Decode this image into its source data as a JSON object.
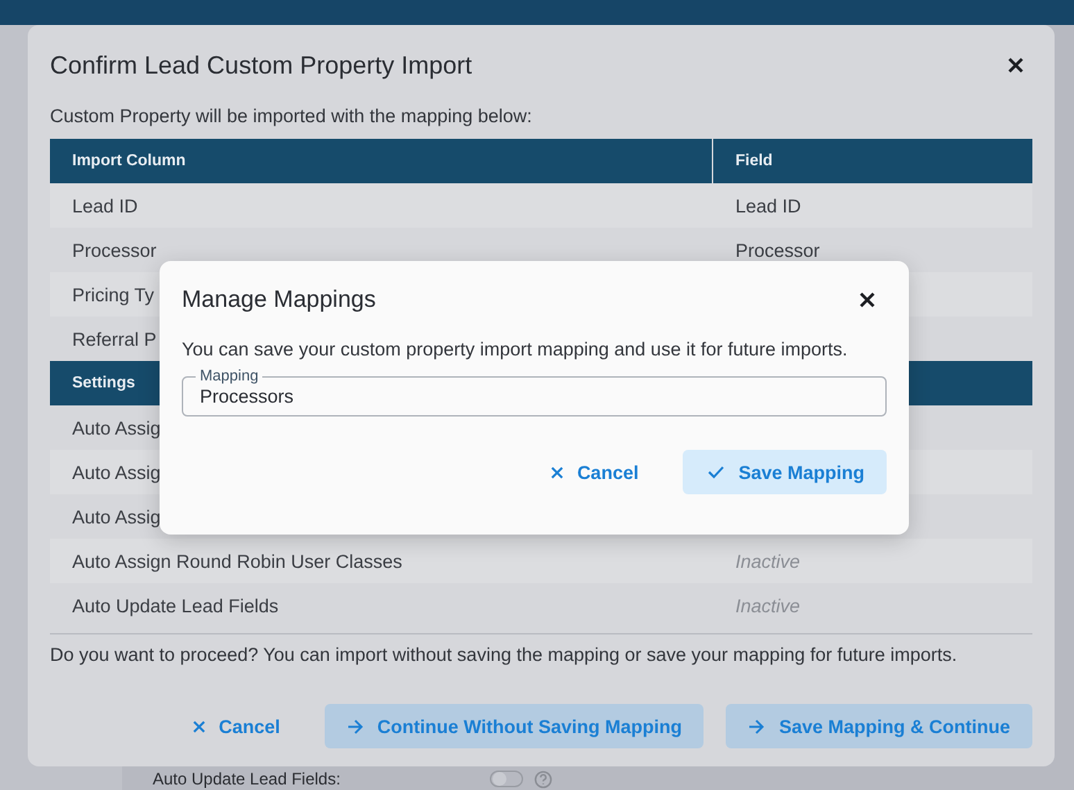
{
  "background": {
    "field_label": "Auto Update Lead Fields:",
    "toggle": {
      "on": false
    }
  },
  "dialog": {
    "title": "Confirm Lead Custom Property Import",
    "intro": "Custom Property will be imported with the mapping below:",
    "columns": [
      "Import Column",
      "Field"
    ],
    "rows": [
      {
        "kind": "row",
        "column": "Lead ID",
        "field": "Lead ID"
      },
      {
        "kind": "row",
        "column": "Processor",
        "field": "Processor"
      },
      {
        "kind": "row",
        "column": "Pricing Ty"
      },
      {
        "kind": "row",
        "column": "Referral P"
      },
      {
        "kind": "section",
        "column": "Settings"
      },
      {
        "kind": "setting",
        "column": "Auto Assig"
      },
      {
        "kind": "setting",
        "column": "Auto Assig"
      },
      {
        "kind": "setting",
        "column": "Auto Assig"
      },
      {
        "kind": "setting",
        "column": "Auto Assign Round Robin User Classes",
        "status": "Inactive"
      },
      {
        "kind": "setting",
        "column": "Auto Update Lead Fields",
        "status": "Inactive"
      }
    ],
    "question": "Do you want to proceed? You can import without saving the mapping or save your mapping for future imports.",
    "buttons": [
      {
        "label": "Cancel",
        "kind": "text"
      },
      {
        "label": "Continue Without Saving Mapping",
        "kind": "filled"
      },
      {
        "label": "Save Mapping & Continue",
        "kind": "filled"
      }
    ]
  },
  "manage_dialog": {
    "title": "Manage Mappings",
    "text": "You can save your custom property import mapping and use it for future imports.",
    "field": {
      "label": "Mapping",
      "value": "Processors"
    },
    "buttons": [
      {
        "label": "Cancel",
        "kind": "text"
      },
      {
        "label": "Save Mapping",
        "kind": "filled"
      }
    ]
  }
}
